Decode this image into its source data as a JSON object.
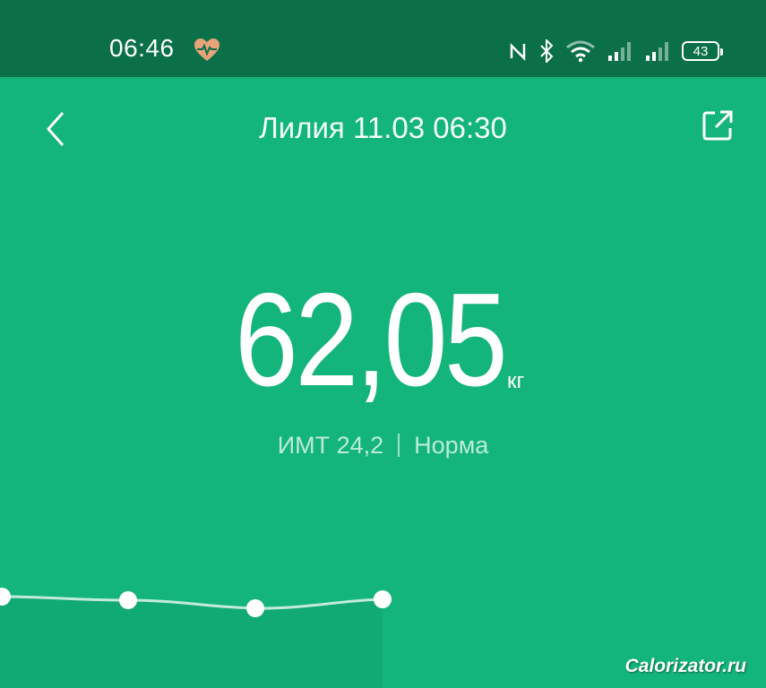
{
  "status_bar": {
    "time": "06:46",
    "battery": "43",
    "icons": [
      "heart-monitor-icon",
      "nfc-icon",
      "bluetooth-icon",
      "wifi-icon",
      "signal-icon",
      "signal-icon-2",
      "battery-icon"
    ]
  },
  "header": {
    "title": "Лилия 11.03 06:30"
  },
  "weight": {
    "value": "62,05",
    "unit": "кг"
  },
  "bmi": {
    "label": "ИМТ 24,2",
    "status": "Норма"
  },
  "chart_data": {
    "type": "line",
    "series": [
      {
        "values": [
          null,
          null,
          null,
          null
        ]
      }
    ]
  },
  "watermark": "Calorizator.ru",
  "colors": {
    "background": "#13b57a",
    "status_bar": "#0b7048",
    "heart": "#e8a37a"
  }
}
